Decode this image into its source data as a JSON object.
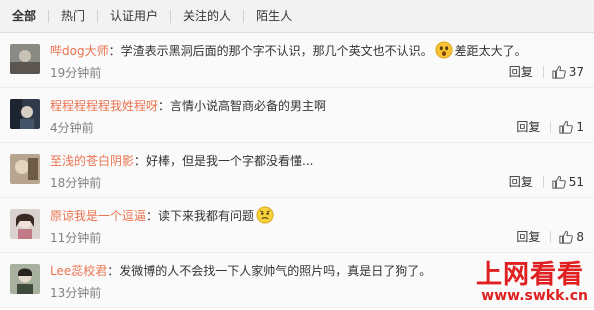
{
  "tabs": [
    {
      "label": "全部",
      "active": true
    },
    {
      "label": "热门",
      "active": false
    },
    {
      "label": "认证用户",
      "active": false
    },
    {
      "label": "关注的人",
      "active": false
    },
    {
      "label": "陌生人",
      "active": false
    }
  ],
  "comments": [
    {
      "username": "哔dog大师",
      "colon": "：",
      "text": "学渣表示黑洞后面的那个字不认识，那几个英文也不认识。",
      "after_emoji": "差距太大了。",
      "emoji": "surprised-emoji",
      "time": "19分钟前",
      "reply": "回复",
      "likes": "37"
    },
    {
      "username": "程程程程程我姓程呀",
      "colon": "：",
      "text": "言情小说高智商必备的男主啊",
      "after_emoji": "",
      "emoji": "",
      "time": "4分钟前",
      "reply": "回复",
      "likes": "1"
    },
    {
      "username": "至浅的苍白阴影",
      "colon": "：",
      "text": "好棒，但是我一个字都没看懂...",
      "after_emoji": "",
      "emoji": "",
      "time": "18分钟前",
      "reply": "回复",
      "likes": "51"
    },
    {
      "username": "原谅我是一个逗逼",
      "colon": "：",
      "text": "读下来我都有问题",
      "after_emoji": "",
      "emoji": "confused-emoji",
      "time": "11分钟前",
      "reply": "回复",
      "likes": "8"
    },
    {
      "username": "Lee蕊校君",
      "colon": "：",
      "text": "发微博的人不会找一下人家帅气的照片吗，真是日了狗了。",
      "after_emoji": "",
      "emoji": "",
      "time": "13分钟前",
      "reply": "回复",
      "likes": ""
    }
  ],
  "watermark": {
    "top": "上网看看",
    "bottom": "www.swkk.cn"
  },
  "colors": {
    "username": "#eb7350",
    "tab_bar": "#f2f2f2",
    "watermark": "#e02020"
  }
}
